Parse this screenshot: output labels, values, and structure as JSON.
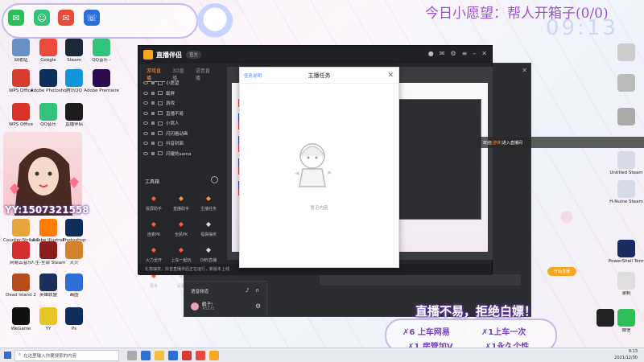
{
  "overlay_banner": "今日小愿望：帮人开箱子(0/0)",
  "clock_overlay": "09:13",
  "camera_overlay_id": "YY:1507321558",
  "desktop_icons": [
    {
      "label": "回收站",
      "color": "#6a8fc5"
    },
    {
      "label": "Google",
      "color": "#e94a3c"
    },
    {
      "label": "Steam",
      "color": "#1b2838"
    },
    {
      "label": "QQ音乐 -",
      "color": "#31c27c"
    },
    {
      "label": "WPS Office",
      "color": "#d83b2f"
    },
    {
      "label": "Adobe Photoshop",
      "color": "#0d2d5a"
    },
    {
      "label": "腾讯QQ",
      "color": "#1296db"
    },
    {
      "label": "Adobe Premiere",
      "color": "#2a0b4e"
    },
    {
      "label": "WPS Office",
      "color": "#d8342a"
    },
    {
      "label": "QQ音乐",
      "color": "#31c27c"
    },
    {
      "label": "直播伴侣",
      "color": "#1c1c1c"
    },
    {
      "label": "Counter-Strike Global Off",
      "color": "#e6a33e"
    },
    {
      "label": "Adobe Illustrat",
      "color": "#ff7c00"
    },
    {
      "label": "Photoshop",
      "color": "#0d2d5a"
    },
    {
      "label": "网易云音乐",
      "color": "#d62f2f"
    },
    {
      "label": "人生-全部 Steam 卡",
      "color": "#8b1d1d"
    },
    {
      "label": "天火",
      "color": "#d6812b"
    },
    {
      "label": "Dead Island 2",
      "color": "#b74c1c"
    },
    {
      "label": "英雄联盟",
      "color": "#1a2f5a"
    },
    {
      "label": "画图",
      "color": "#2c6fd8"
    },
    {
      "label": "WeGame",
      "color": "#111"
    },
    {
      "label": "YY",
      "color": "#e8c527"
    },
    {
      "label": "Ps",
      "color": "#0d2d5a"
    }
  ],
  "right_icons": [
    "Untitled Steam",
    "H-Nuine Steam",
    "PowerShell Terminator",
    "录制",
    "微信"
  ],
  "app": {
    "name": "直播伴侣",
    "version": "官方",
    "side_tabs": [
      "游戏直播",
      "3D直播",
      "语音直播"
    ],
    "scenes": [
      "小愿望",
      "截屏",
      "游戏",
      "直播不易",
      "小窝人",
      "闪闪看动画",
      "抖音封面",
      "闪耀的sama"
    ],
    "tools_title": "工具箱",
    "tools": [
      {
        "label": "投屏助手",
        "color": "#ff5a3a"
      },
      {
        "label": "直播助手",
        "color": "#ff8d3a"
      },
      {
        "label": "主播任务",
        "color": "#ff8d3a"
      },
      {
        "label": "连麦PK",
        "color": "#ff5a3a"
      },
      {
        "label": "全民PK",
        "color": "#ff5a3a"
      },
      {
        "label": "福袋抽奖",
        "color": "#ddd"
      },
      {
        "label": "火力全开",
        "color": "#ff5a3a"
      },
      {
        "label": "上车一起玩",
        "color": "#ff5a3a"
      },
      {
        "label": "OBS直播",
        "color": "#ddd"
      },
      {
        "label": "更多",
        "color": "#ff5a3a"
      },
      {
        "label": "设置",
        "color": "#ddd"
      }
    ],
    "status_text": "礼物抽奖，抖音直播伴侣正在运行，新版本上线",
    "start_label": "开始直播"
  },
  "dialog": {
    "title": "主播任务",
    "rule_link": "任务说明",
    "empty_text": "暂无内容"
  },
  "notification": {
    "prefix": "欢迎",
    "user": "[游侠]",
    "suffix": "进入直播间"
  },
  "chat_panel": {
    "title": "语音频道",
    "user_name": "鹤子!",
    "user_id": "#5575"
  },
  "slogan": "直播不易，拒绝白嫖！",
  "gifts": [
    "✗6 上车网易",
    "✗1上车一次",
    "✗1 房管加V",
    "✗1永久个性"
  ],
  "taskbar": {
    "search_placeholder": "在这里输入你要搜索的内容",
    "time": "9:13",
    "date": "2021/12/30"
  }
}
